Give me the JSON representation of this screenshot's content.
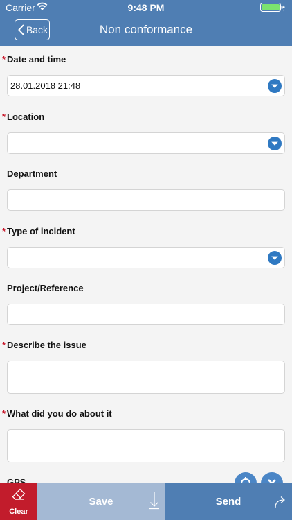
{
  "status_bar": {
    "carrier": "Carrier",
    "time": "9:48 PM",
    "wifi_icon": "wifi-icon",
    "battery_icon": "battery-charging-icon"
  },
  "nav": {
    "back_label": "Back",
    "title": "Non conformance"
  },
  "required_mark": "*",
  "fields": {
    "date_time": {
      "label": "Date and time",
      "value": "28.01.2018 21:48"
    },
    "location": {
      "label": "Location",
      "value": ""
    },
    "department": {
      "label": "Department",
      "value": ""
    },
    "incident_type": {
      "label": "Type of incident",
      "value": ""
    },
    "project_reference": {
      "label": "Project/Reference",
      "value": ""
    },
    "describe_issue": {
      "label": "Describe the issue",
      "value": ""
    },
    "action_taken": {
      "label": "What did you do about it",
      "value": ""
    },
    "gps": {
      "label": "GPS"
    }
  },
  "bottom": {
    "clear_label": "Clear",
    "save_label": "Save",
    "send_label": "Send"
  },
  "colors": {
    "header": "#4f7eb3",
    "dropdown": "#2f79c2",
    "required": "#c8172a",
    "clear": "#c21c2c",
    "save": "#a4b9d4",
    "send": "#4f7eb3"
  }
}
